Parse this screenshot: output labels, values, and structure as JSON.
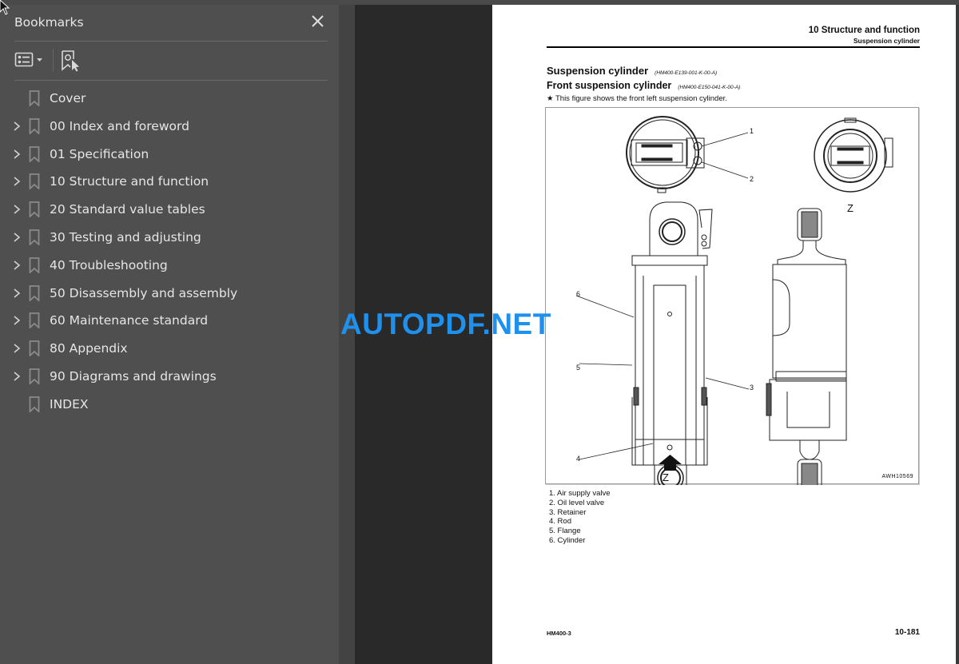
{
  "sidebar": {
    "title": "Bookmarks",
    "close_icon": "close-icon",
    "tools": [
      {
        "name": "bookmark-options",
        "icon": "list-options-icon"
      },
      {
        "name": "expand-current-bookmark",
        "icon": "bookmark-find-icon"
      }
    ],
    "items": [
      {
        "label": "Cover",
        "expandable": false
      },
      {
        "label": "00 Index and foreword",
        "expandable": true
      },
      {
        "label": "01 Specification",
        "expandable": true
      },
      {
        "label": "10 Structure and function",
        "expandable": true
      },
      {
        "label": "20 Standard value tables",
        "expandable": true
      },
      {
        "label": "30 Testing and adjusting",
        "expandable": true
      },
      {
        "label": "40 Troubleshooting",
        "expandable": true
      },
      {
        "label": "50 Disassembly and assembly",
        "expandable": true
      },
      {
        "label": "60 Maintenance standard",
        "expandable": true
      },
      {
        "label": "80 Appendix",
        "expandable": true
      },
      {
        "label": "90 Diagrams and drawings",
        "expandable": true
      },
      {
        "label": "INDEX",
        "expandable": false
      }
    ]
  },
  "page": {
    "header_title": "10 Structure and function",
    "header_subtitle": "Suspension cylinder",
    "heading1": "Suspension cylinder",
    "heading1_code": "(HM400-E139-001-K-00-A)",
    "heading2": "Front suspension cylinder",
    "heading2_code": "(HM400-E150-041-K-00-A)",
    "note": "★  This figure shows the front left suspension cylinder.",
    "figure": {
      "id": "AWH10569",
      "callouts": [
        "1",
        "2",
        "3",
        "4",
        "5",
        "6"
      ],
      "view_label": "Z"
    },
    "legend": [
      "1.  Air supply valve",
      "2.  Oil level valve",
      "3.  Retainer",
      "4.  Rod",
      "5.  Flange",
      "6.  Cylinder"
    ],
    "footer_model": "HM400-3",
    "footer_page": "10-181"
  },
  "watermark": "AUTOPDF.NET",
  "colors": {
    "sidebar_bg": "#4f4f4f",
    "viewer_bg": "#292929",
    "watermark": "#1e90ee"
  }
}
